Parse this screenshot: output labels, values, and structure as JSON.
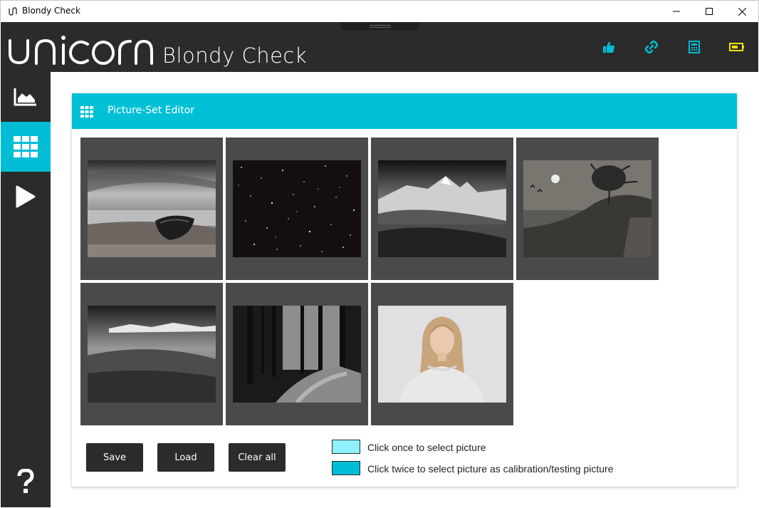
{
  "window": {
    "title": "Blondy Check"
  },
  "header": {
    "logo_text": "unicorn",
    "app_name": "Blondy Check",
    "icons": [
      "thumbs-up-icon",
      "link-icon",
      "calculator-icon",
      "battery-icon"
    ],
    "accent_color": "#00bcd4",
    "battery_color": "#f5e100"
  },
  "sidebar": {
    "items": [
      {
        "name": "chart",
        "icon": "area-chart-icon",
        "active": false
      },
      {
        "name": "picture-set-editor",
        "icon": "grid-icon",
        "active": true
      },
      {
        "name": "play",
        "icon": "play-icon",
        "active": false
      }
    ],
    "help_icon": "help-icon"
  },
  "editor": {
    "title": "Picture-Set Editor",
    "pictures": [
      {
        "subject": "boat on beach"
      },
      {
        "subject": "starry sky"
      },
      {
        "subject": "mountain peaks"
      },
      {
        "subject": "hillside with tree"
      },
      {
        "subject": "misty meadow"
      },
      {
        "subject": "forest path"
      },
      {
        "subject": "blonde woman portrait"
      }
    ],
    "buttons": {
      "save": "Save",
      "load": "Load",
      "clear": "Clear all"
    },
    "legend": [
      {
        "color": "#8ef1fb",
        "text": "Click once to select picture"
      },
      {
        "color": "#00bcd4",
        "text": "Click twice to select picture as calibration/testing picture"
      }
    ]
  }
}
